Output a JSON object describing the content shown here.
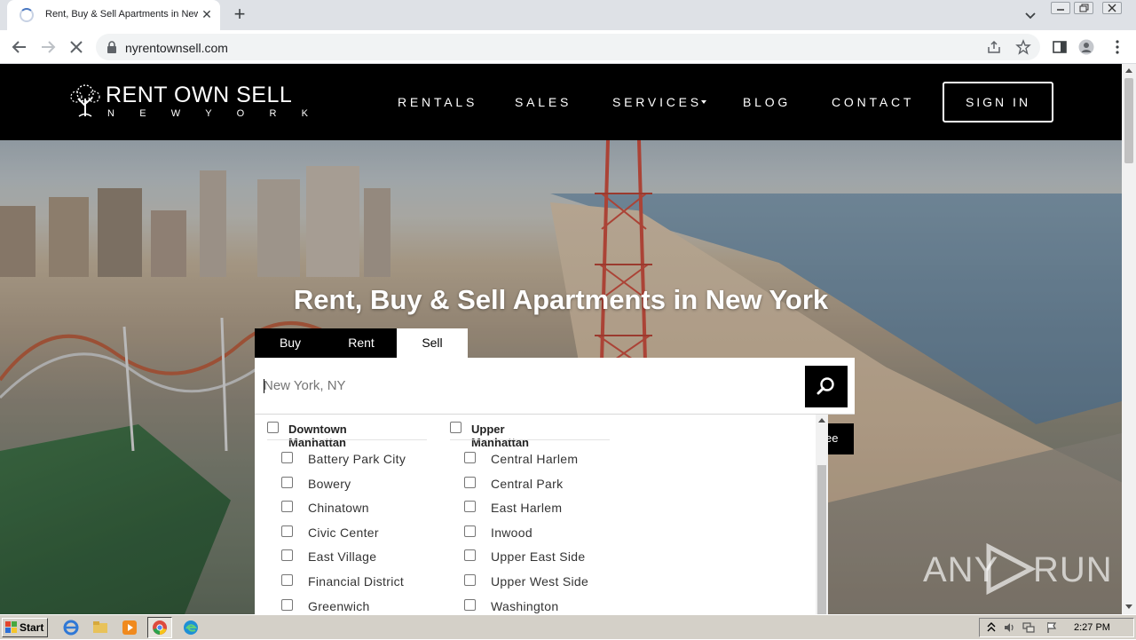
{
  "browser": {
    "tab_title": "Rent, Buy & Sell Apartments in New",
    "tab_close": "✕",
    "new_tab": "+",
    "url": "nyrentownsell.com"
  },
  "site": {
    "logo": {
      "name": "RENT OWN SELL",
      "city": "N E W Y O R K"
    },
    "nav": {
      "rentals": "RENTALS",
      "sales": "SALES",
      "services": "SERVICES",
      "blog": "BLOG",
      "contact": "CONTACT",
      "sign_in": "SIGN IN"
    },
    "hero": {
      "headline": "Rent, Buy & Sell Apartments in New York"
    },
    "search": {
      "tabs": {
        "buy": "Buy",
        "rent": "Rent",
        "sell": "Sell"
      },
      "active_tab": "Sell",
      "placeholder": "New York, NY",
      "partially_hidden_button": "ee"
    },
    "neighborhoods": {
      "groups": [
        {
          "label": "Downtown Manhattan",
          "items": [
            "Battery Park City",
            "Bowery",
            "Chinatown",
            "Civic Center",
            "East Village",
            "Financial District",
            "Greenwich"
          ]
        },
        {
          "label": "Upper Manhattan",
          "items": [
            "Central Harlem",
            "Central Park",
            "East Harlem",
            "Inwood",
            "Upper East Side",
            "Upper West Side",
            "Washington"
          ]
        }
      ]
    },
    "watermark": {
      "left": "ANY",
      "right": "RUN"
    }
  },
  "taskbar": {
    "start": "Start",
    "clock": "2:27 PM"
  },
  "colors": {
    "header_bg": "#000000",
    "chrome_tabstrip": "#dee1e6",
    "taskbar": "#d4d0c8"
  }
}
